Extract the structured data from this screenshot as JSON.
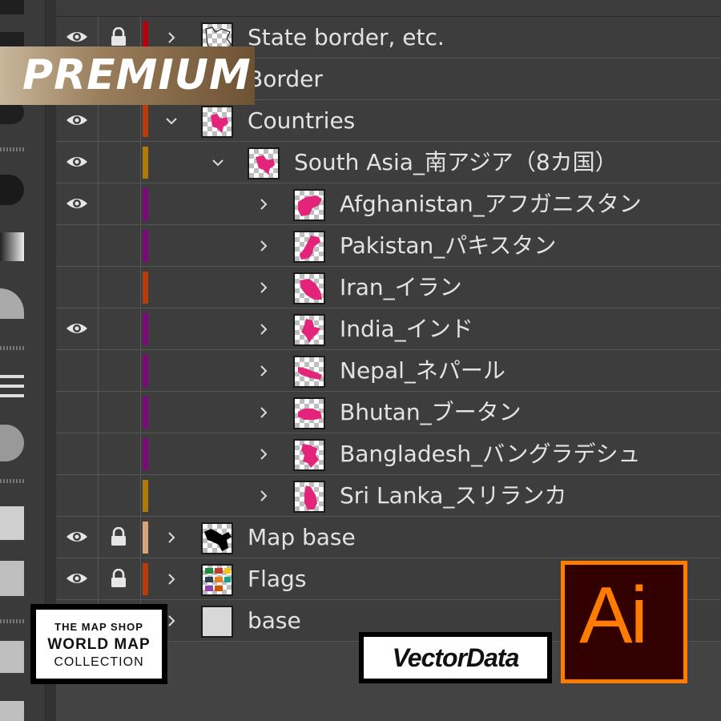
{
  "layers": [
    {
      "label": "State border, etc.",
      "eye": true,
      "lock": true,
      "color": "#b5000e",
      "indent": 0,
      "expanded": false,
      "thumb": "border-thumbnail"
    },
    {
      "label": "Border",
      "eye": true,
      "lock": false,
      "color": "#b5000e",
      "indent": 0,
      "expanded": false,
      "thumb": "border-thumbnail"
    },
    {
      "label": "Countries",
      "eye": true,
      "lock": false,
      "color": "#b83b0a",
      "indent": 0,
      "expanded": true,
      "thumb": "countries-thumbnail"
    },
    {
      "label": "South Asia_南アジア（8カ国）",
      "eye": true,
      "lock": false,
      "color": "#b07a0a",
      "indent": 1,
      "expanded": true,
      "thumb": "south-asia-thumbnail"
    },
    {
      "label": "Afghanistan_アフガニスタン",
      "eye": true,
      "lock": false,
      "color": "#7a0a7a",
      "indent": 2,
      "expanded": false,
      "thumb": "afghanistan-thumbnail"
    },
    {
      "label": "Pakistan_パキスタン",
      "eye": false,
      "lock": false,
      "color": "#7a0a7a",
      "indent": 2,
      "expanded": false,
      "thumb": "pakistan-thumbnail"
    },
    {
      "label": "Iran_イラン",
      "eye": false,
      "lock": false,
      "color": "#b83b0a",
      "indent": 2,
      "expanded": false,
      "thumb": "iran-thumbnail"
    },
    {
      "label": "India_インド",
      "eye": true,
      "lock": false,
      "color": "#7a0a7a",
      "indent": 2,
      "expanded": false,
      "thumb": "india-thumbnail"
    },
    {
      "label": "Nepal_ネパール",
      "eye": false,
      "lock": false,
      "color": "#7a0a7a",
      "indent": 2,
      "expanded": false,
      "thumb": "nepal-thumbnail"
    },
    {
      "label": "Bhutan_ブータン",
      "eye": false,
      "lock": false,
      "color": "#7a0a7a",
      "indent": 2,
      "expanded": false,
      "thumb": "bhutan-thumbnail"
    },
    {
      "label": "Bangladesh_バングラデシュ",
      "eye": false,
      "lock": false,
      "color": "#7a0a7a",
      "indent": 2,
      "expanded": false,
      "thumb": "bangladesh-thumbnail"
    },
    {
      "label": "Sri Lanka_スリランカ",
      "eye": false,
      "lock": false,
      "color": "#b07a0a",
      "indent": 2,
      "expanded": false,
      "thumb": "sri-lanka-thumbnail"
    },
    {
      "label": "Map base",
      "eye": true,
      "lock": true,
      "color": "#d8a57a",
      "indent": 0,
      "expanded": false,
      "thumb": "map-base-thumbnail"
    },
    {
      "label": "Flags",
      "eye": true,
      "lock": true,
      "color": "#b83b0a",
      "indent": 0,
      "expanded": false,
      "thumb": "flags-thumbnail"
    },
    {
      "label": "base",
      "eye": false,
      "lock": false,
      "color": "#b83b0a",
      "indent": 0,
      "expanded": false,
      "thumb": "base-thumbnail"
    }
  ],
  "badges": {
    "premium": "PREMIUM",
    "mapshop_line1": "THE MAP SHOP",
    "mapshop_line2": "WORLD MAP",
    "mapshop_line3": "COLLECTION",
    "vector": "VectorData",
    "ai": "Ai"
  },
  "colors": {
    "country_fill": "#e4247a",
    "ai_orange": "#ff7c00",
    "ai_background": "#330000"
  }
}
